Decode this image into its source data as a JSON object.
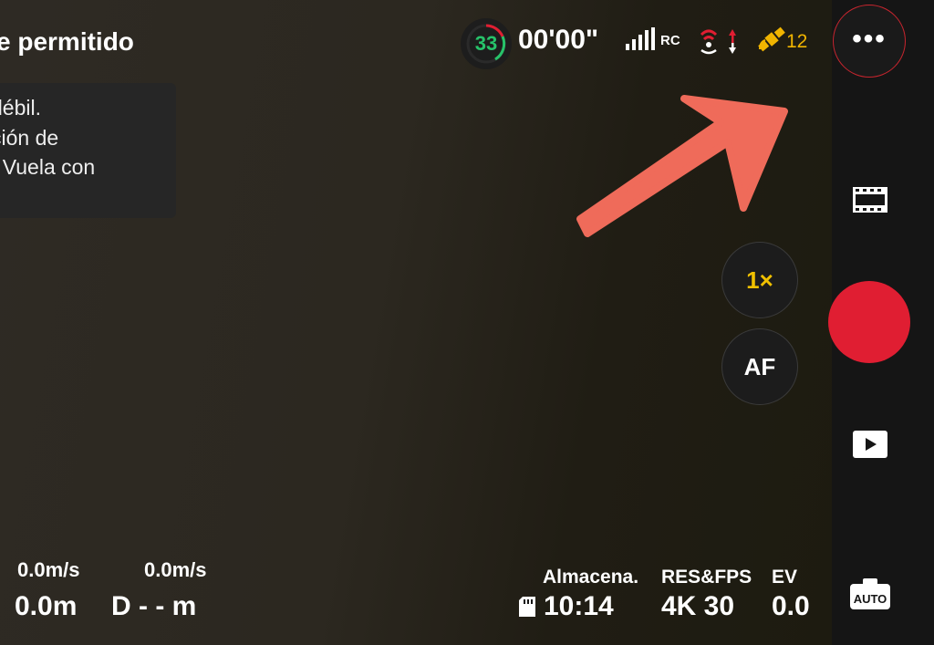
{
  "banner": {
    "title": "e permitido",
    "lines": [
      "débil.",
      "ción de",
      ". Vuela con"
    ]
  },
  "status": {
    "battery_percent": "33",
    "flight_time": "00'00\"",
    "rc_label": "RC",
    "satellites": "12",
    "more_label": "•••"
  },
  "controls": {
    "zoom_label": "1×",
    "af_label": "AF",
    "auto_label": "AUTO"
  },
  "telemetry": {
    "h_speed": "0.0m/s",
    "h_value": "0.0m",
    "d_speed": "0.0m/s",
    "d_label": "D",
    "d_value": "- - m"
  },
  "camera_info": {
    "storage_label": "Almacena.",
    "storage_value": "10:14",
    "res_label": "RES&FPS",
    "res_value": "4K 30",
    "ev_label": "EV",
    "ev_value": "0.0"
  },
  "colors": {
    "accent_red": "#e01e32",
    "battery_green": "#27c36a",
    "highlight_yellow": "#f0c000",
    "annotation_arrow": "#ef6b5a"
  }
}
